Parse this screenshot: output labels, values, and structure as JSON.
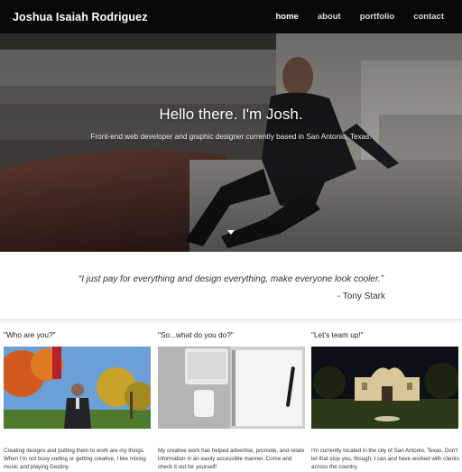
{
  "navbar": {
    "brand": "Joshua Isaiah Rodriguez",
    "links": [
      "home",
      "about",
      "portfolio",
      "contact"
    ]
  },
  "hero": {
    "title": "Hello there. I'm Josh.",
    "subtitle": "Front-end web developer and graphic designer currently based in San Antonio, Texas.",
    "icons": {
      "scroll": "chevron-down-icon"
    }
  },
  "quote": {
    "text": "“I just pay for everything and design everything, make everyone look cooler.”",
    "author": "- Tony Stark"
  },
  "cards": [
    {
      "title": "\"Who are you?\"",
      "text": "Creating designs and putting them to work are my things. When I'm not busy coding or getting creative, I like mixing music and playing Destiny."
    },
    {
      "title": "\"So...what do you do?\"",
      "text": "My creative work has helped advertise, promote, and relate information in an easily accessible manner. Come and check it out for yourself!"
    },
    {
      "title": "\"Let's team up!\"",
      "text": "I'm currently located in the city of San Antonio, Texas. Don't let that stop you, though. I can and have worked with clients across the country."
    }
  ]
}
